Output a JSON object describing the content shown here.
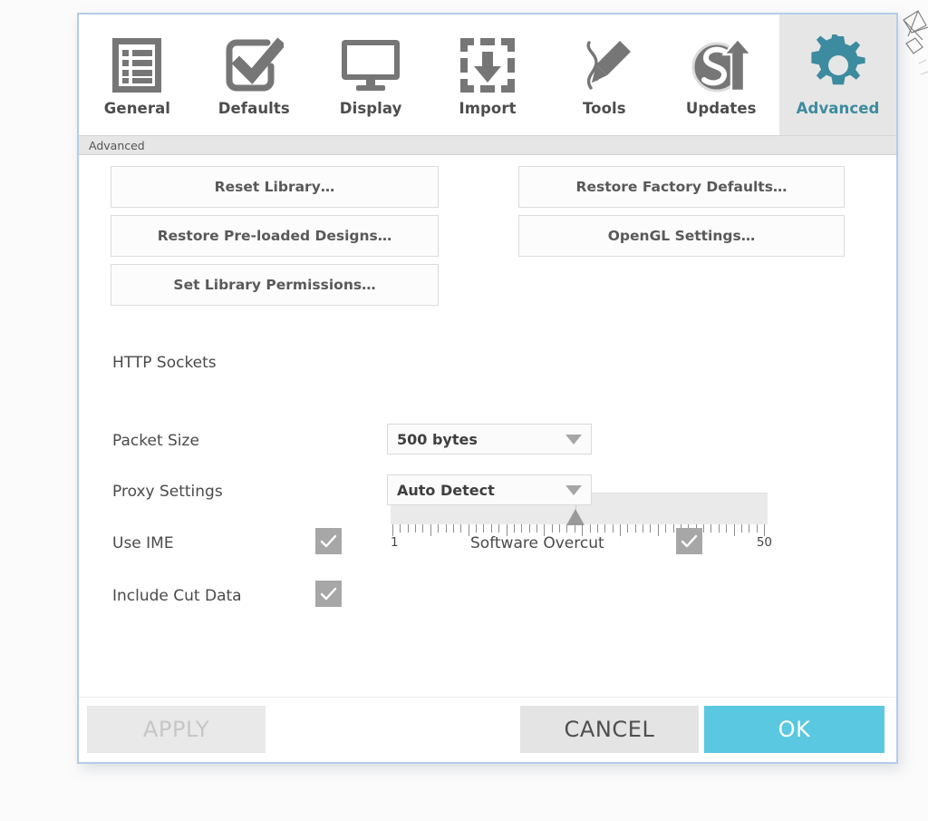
{
  "dialog": {
    "accent_teal": "#3d8b9e",
    "accent_cyan": "#5ac8e0",
    "border_color": "#b3cde8"
  },
  "tabs": [
    {
      "label": "General",
      "icon": "list-document-icon",
      "selected": false
    },
    {
      "label": "Defaults",
      "icon": "checkbox-check-icon",
      "selected": false
    },
    {
      "label": "Display",
      "icon": "monitor-icon",
      "selected": false
    },
    {
      "label": "Import",
      "icon": "dashed-box-download-icon",
      "selected": false
    },
    {
      "label": "Tools",
      "icon": "pencil-curve-icon",
      "selected": false
    },
    {
      "label": "Updates",
      "icon": "s-circle-up-arrow-icon",
      "selected": false
    },
    {
      "label": "Advanced",
      "icon": "gear-icon",
      "selected": true
    }
  ],
  "breadcrumb": {
    "text": "Advanced"
  },
  "actions": {
    "reset_library": "Reset Library…",
    "restore_preloaded": "Restore Pre-loaded Designs…",
    "set_permissions": "Set Library Permissions…",
    "restore_factory": "Restore Factory Defaults…",
    "opengl_settings": "OpenGL Settings…"
  },
  "settings": {
    "http_sockets": {
      "label": "HTTP Sockets",
      "min_label": "1",
      "max_label": "50",
      "min": 1,
      "max": 50,
      "value": 25,
      "ticks": 50
    },
    "packet_size": {
      "label": "Packet Size",
      "value": "500 bytes",
      "arrow_icon": "chevron-down-icon"
    },
    "proxy_settings": {
      "label": "Proxy Settings",
      "value": "Auto Detect",
      "arrow_icon": "chevron-down-icon"
    },
    "use_ime": {
      "label": "Use IME",
      "checked": true,
      "icon": "check-icon"
    },
    "software_overcut": {
      "label": "Software Overcut",
      "checked": true,
      "icon": "check-icon"
    },
    "include_cut_data": {
      "label": "Include Cut Data",
      "checked": true,
      "icon": "check-icon"
    }
  },
  "footer": {
    "apply": "APPLY",
    "cancel": "CANCEL",
    "ok": "OK"
  }
}
